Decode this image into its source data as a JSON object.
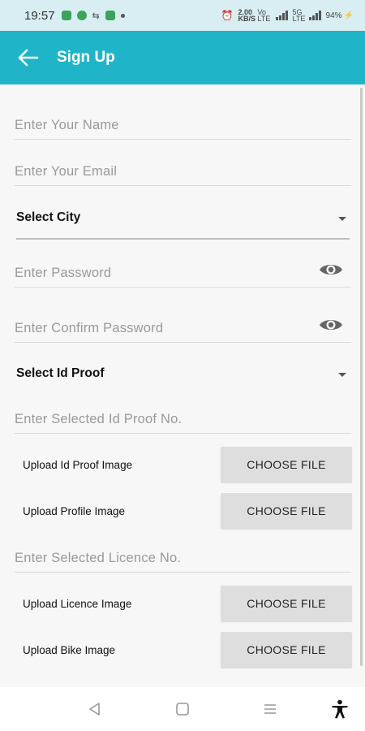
{
  "status_bar": {
    "time": "19:57",
    "network_speed": "2.00 KB/S",
    "net_type_1": "Vo LTE",
    "net_type_2": "5G LTE",
    "battery": "94%"
  },
  "app_bar": {
    "title": "Sign Up",
    "back_icon": "arrow-left-icon",
    "background_color": "#20b4c8"
  },
  "form": {
    "name_placeholder": "Enter Your Name",
    "email_placeholder": "Enter Your Email",
    "city_select": "Select City",
    "password_placeholder": "Enter Password",
    "confirm_password_placeholder": "Enter Confirm Password",
    "id_proof_select": "Select Id Proof",
    "id_proof_no_placeholder": "Enter Selected Id Proof No.",
    "upload_id_proof_label": "Upload Id Proof Image",
    "upload_profile_label": "Upload Profile Image",
    "licence_no_placeholder": "Enter Selected Licence No.",
    "upload_licence_label": "Upload Licence Image",
    "upload_bike_label": "Upload Bike Image",
    "choose_file_label": "CHOOSE FILE"
  },
  "nav_bar": {
    "back_icon": "triangle-back-icon",
    "home_icon": "square-home-icon",
    "recents_icon": "menu-lines-icon",
    "accessibility_icon": "accessibility-icon"
  }
}
